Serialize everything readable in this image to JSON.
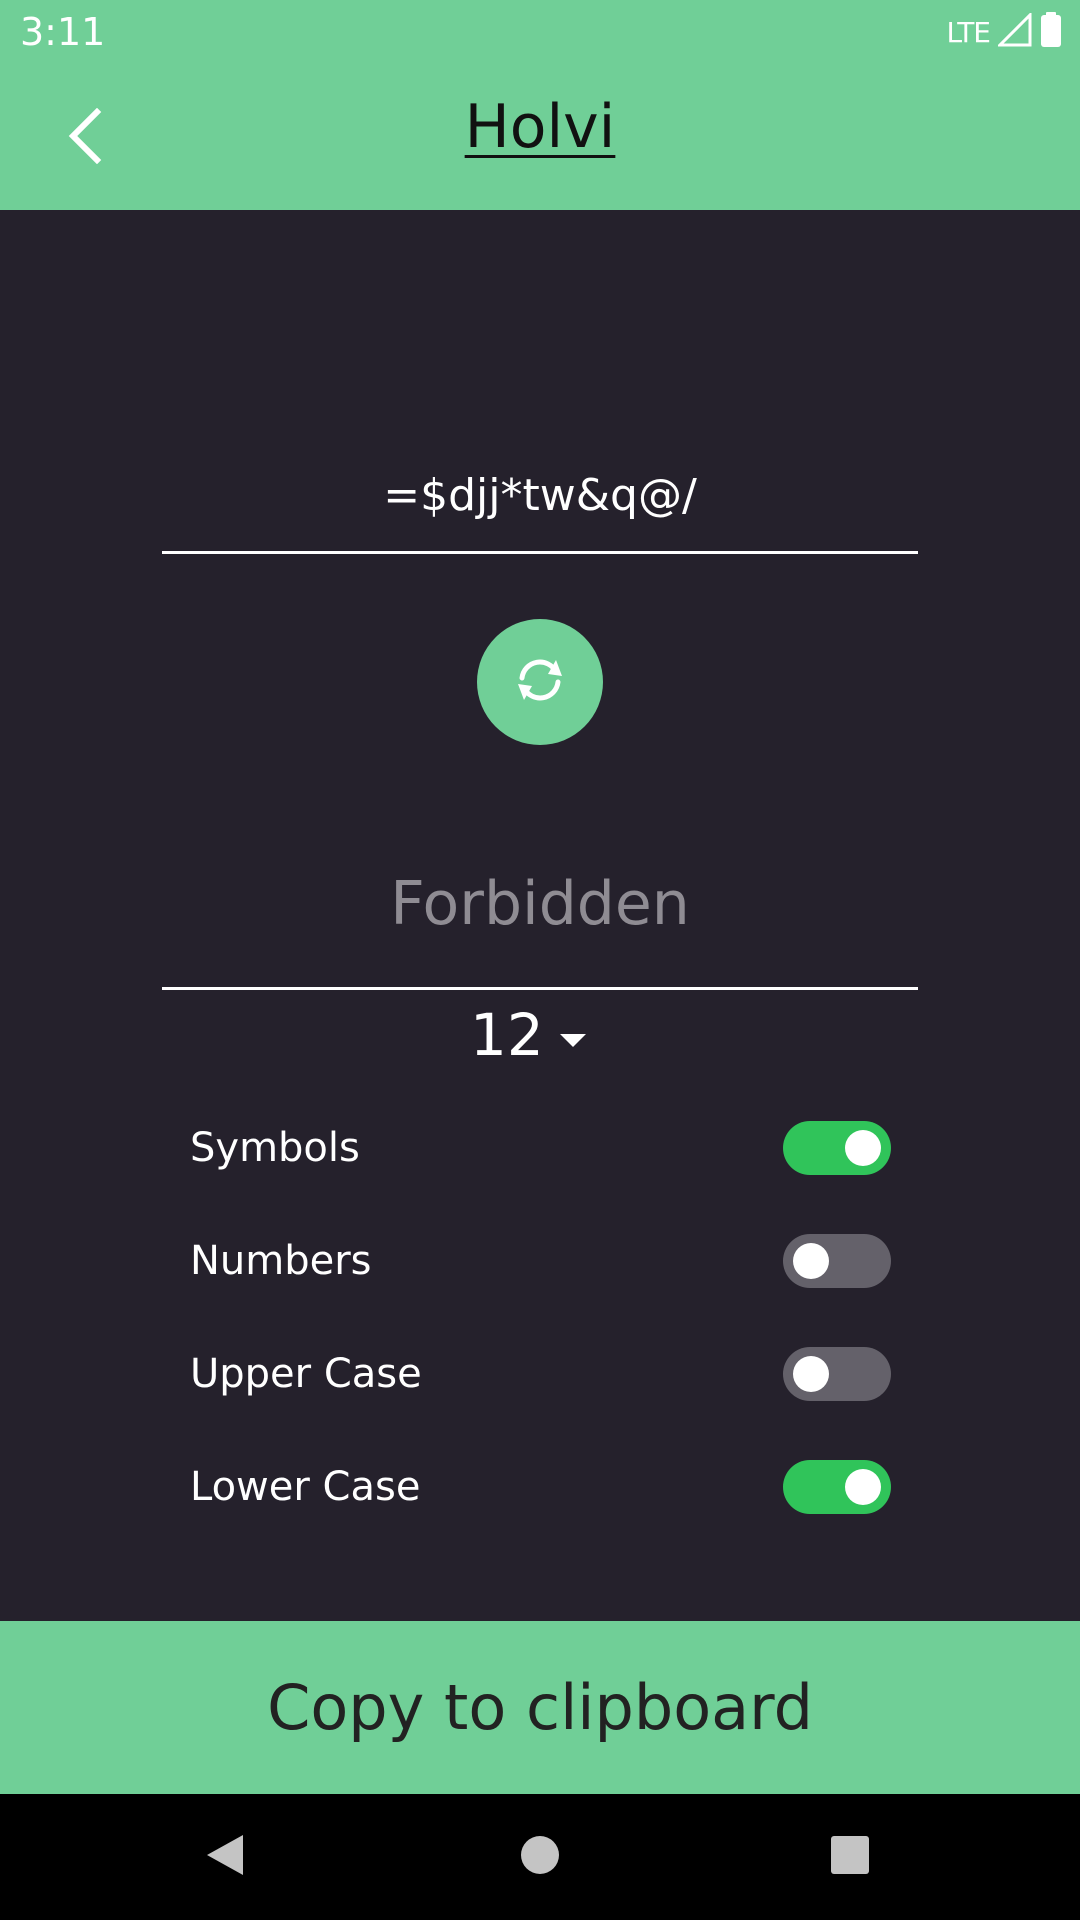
{
  "status_bar": {
    "time": "3:11",
    "network": "LTE",
    "icons": [
      "signal-icon",
      "battery-icon"
    ]
  },
  "app_bar": {
    "title": "Holvi",
    "back_icon": "chevron-left-icon"
  },
  "generator": {
    "password": "=$djj*tw&q@/",
    "refresh_icon": "refresh-icon",
    "forbidden_placeholder": "Forbidden",
    "forbidden_value": "",
    "length": "12"
  },
  "options": [
    {
      "label": "Symbols",
      "on": true
    },
    {
      "label": "Numbers",
      "on": false
    },
    {
      "label": "Upper Case",
      "on": false
    },
    {
      "label": "Lower Case",
      "on": true
    }
  ],
  "copy_button": {
    "label": "Copy to clipboard"
  },
  "nav_bar": {
    "icons": [
      "back-triangle-icon",
      "home-circle-icon",
      "recents-square-icon"
    ]
  },
  "colors": {
    "accent": "#70cf97",
    "background": "#25212c",
    "toggle_on": "#30c45a",
    "toggle_off": "#64616a"
  }
}
